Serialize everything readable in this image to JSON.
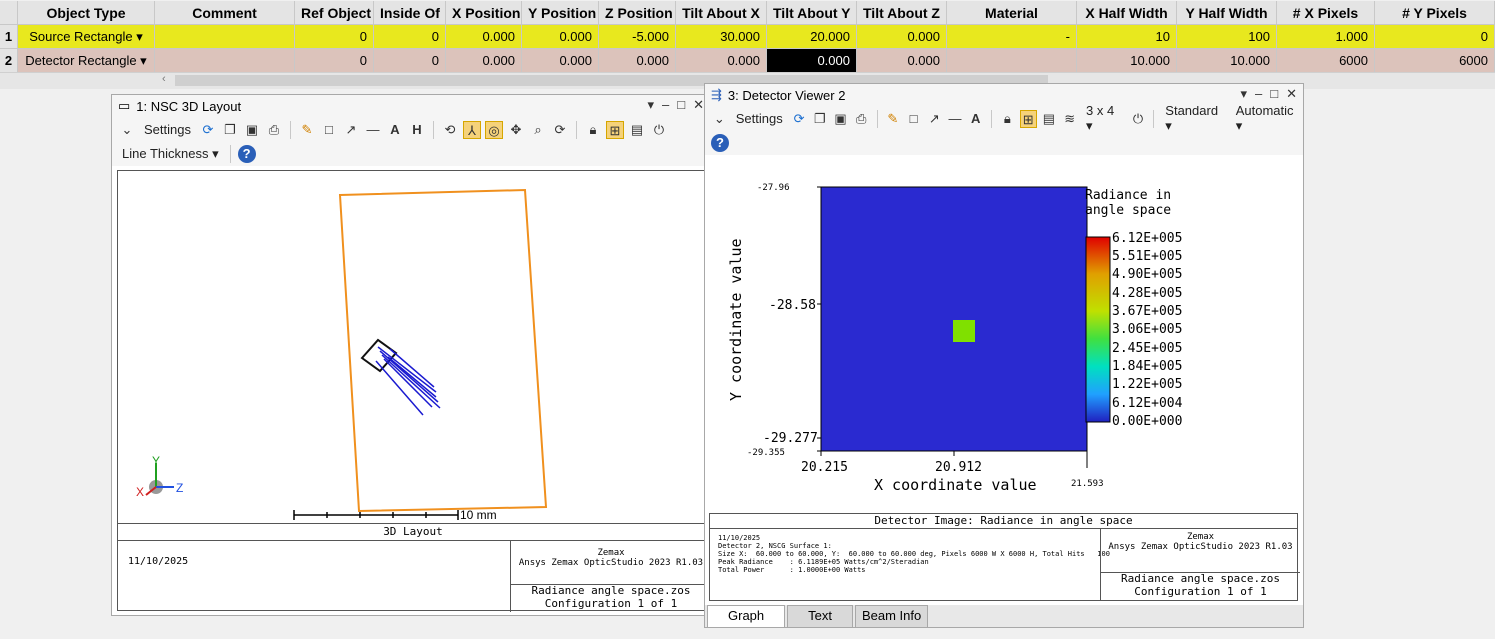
{
  "grid": {
    "headers": [
      "Object Type",
      "Comment",
      "Ref Object",
      "Inside Of",
      "X Position",
      "Y Position",
      "Z Position",
      "Tilt About X",
      "Tilt About Y",
      "Tilt About Z",
      "Material",
      "X Half Width",
      "Y Half Width",
      "# X Pixels",
      "# Y Pixels"
    ],
    "rows": [
      {
        "num": "1",
        "type": "Source Rectangle ▾",
        "comment": "",
        "ref": "0",
        "inside": "0",
        "xpos": "0.000",
        "ypos": "0.000",
        "zpos": "-5.000",
        "tiltx": "30.000",
        "tilty": "20.000",
        "tiltz": "0.000",
        "material": "-",
        "xhalf": "10",
        "yhalf": "100",
        "xpix": "1.000",
        "ypix": "0"
      },
      {
        "num": "2",
        "type": "Detector Rectangle ▾",
        "comment": "",
        "ref": "0",
        "inside": "0",
        "xpos": "0.000",
        "ypos": "0.000",
        "zpos": "0.000",
        "tiltx": "0.000",
        "tilty": "0.000",
        "tiltz": "0.000",
        "material": "",
        "xhalf": "10.000",
        "yhalf": "10.000",
        "xpix": "6000",
        "ypix": "6000"
      }
    ]
  },
  "layout_window": {
    "title": "1: NSC 3D Layout",
    "settings_label": "Settings",
    "line_thickness_label": "Line Thickness ▾",
    "scale_label": "10 mm",
    "axis_y": "Y",
    "axis_z": "Z",
    "axis_x": "X",
    "plot_title": "3D Layout",
    "date": "11/10/2025",
    "company": "Zemax",
    "product": "Ansys Zemax OpticStudio 2023 R1.03",
    "file": "Radiance angle space.zos",
    "config": "Configuration 1 of 1"
  },
  "detector_window": {
    "title": "3: Detector Viewer 2",
    "settings_label": "Settings",
    "grid_label": "3 x 4 ▾",
    "standard_label": "Standard ▾",
    "automatic_label": "Automatic ▾",
    "legend_title_1": "Radiance in",
    "legend_title_2": "angle space",
    "colorbar": [
      "6.12E+005",
      "5.51E+005",
      "4.90E+005",
      "4.28E+005",
      "3.67E+005",
      "3.06E+005",
      "2.45E+005",
      "1.84E+005",
      "1.22E+005",
      "6.12E+004",
      "0.00E+000"
    ],
    "ytick_top": "-27.96",
    "ytick_mid": "-28.58",
    "ytick_low": "-29.277",
    "ytick_bottom": "-29.355",
    "xtick_left": "20.215",
    "xtick_mid": "20.912",
    "xtick_right": "21.593",
    "xlabel": "X coordinate value",
    "ylabel": "Y coordinate value",
    "image_title": "Detector Image: Radiance in angle space",
    "date": "11/10/2025",
    "info1": "Detector 2, NSCG Surface 1:",
    "info2": "Size X:  60.000 to 60.000, Y:  60.000 to 60.000 deg, Pixels 6000 W X 6000 H, Total Hits   100",
    "info3": "Peak Radiance    : 6.1189E+05 Watts/cm^2/Steradian",
    "info4": "Total Power      : 1.0000E+00 Watts",
    "company": "Zemax",
    "product": "Ansys Zemax OpticStudio 2023 R1.03",
    "file": "Radiance angle space.zos",
    "config": "Configuration 1 of 1",
    "tabs": [
      "Graph",
      "Text",
      "Beam Info"
    ]
  },
  "colors": {
    "source_row": "#e8e81e",
    "detector_row": "#dcc3bb",
    "plot_bg": "#2a2ad0",
    "hot_pixel": "#80e000",
    "rect": "#f0901e",
    "rays": "#1a1ad0"
  }
}
